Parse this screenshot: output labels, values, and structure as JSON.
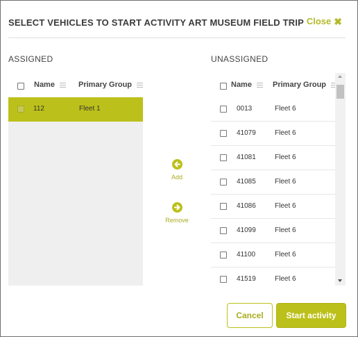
{
  "dialog": {
    "title": "SELECT VEHICLES TO START ACTIVITY ART MUSEUM FIELD TRIP",
    "close_label": "Close",
    "close_glyph": "✖"
  },
  "assigned": {
    "section_label": "ASSIGNED",
    "columns": {
      "name": "Name",
      "group": "Primary Group"
    },
    "rows": [
      {
        "name": "112",
        "group": "Fleet 1",
        "selected": true
      }
    ]
  },
  "unassigned": {
    "section_label": "UNASSIGNED",
    "columns": {
      "name": "Name",
      "group": "Primary Group"
    },
    "rows": [
      {
        "name": "0013",
        "group": "Fleet 6"
      },
      {
        "name": "41079",
        "group": "Fleet 6"
      },
      {
        "name": "41081",
        "group": "Fleet 6"
      },
      {
        "name": "41085",
        "group": "Fleet 6"
      },
      {
        "name": "41086",
        "group": "Fleet 6"
      },
      {
        "name": "41099",
        "group": "Fleet 6"
      },
      {
        "name": "41100",
        "group": "Fleet 6"
      },
      {
        "name": "41519",
        "group": "Fleet 6"
      }
    ]
  },
  "actions": {
    "add_label": "Add",
    "add_icon": "arrow-left-circle-icon",
    "remove_label": "Remove",
    "remove_icon": "arrow-right-circle-icon"
  },
  "footer": {
    "cancel_label": "Cancel",
    "start_label": "Start activity"
  },
  "colors": {
    "accent": "#bcc01a",
    "accent_text": "#a9ad1f",
    "panel_bg": "#efefef"
  }
}
